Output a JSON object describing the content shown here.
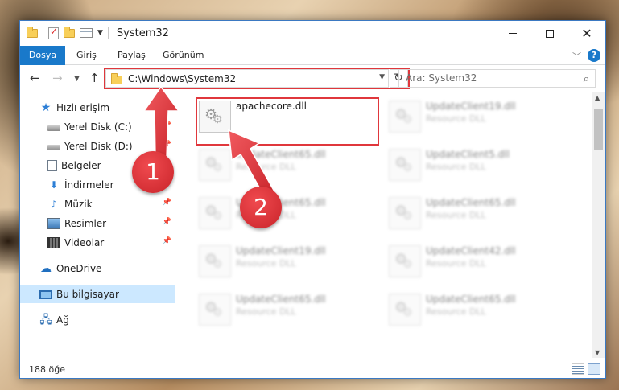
{
  "window": {
    "title": "System32"
  },
  "ribbon": {
    "tabs": [
      "Dosya",
      "Giriş",
      "Paylaş",
      "Görünüm"
    ],
    "help": "?"
  },
  "navigation": {
    "address": "C:\\Windows\\System32",
    "search_placeholder": "Ara: System32"
  },
  "sidebar": {
    "items": [
      {
        "label": "Hızlı erişim",
        "icon": "star-icon"
      },
      {
        "label": "Yerel Disk (C:)",
        "icon": "disk-icon",
        "pinned": true
      },
      {
        "label": "Yerel Disk (D:)",
        "icon": "disk-icon",
        "pinned": true
      },
      {
        "label": "Belgeler",
        "icon": "document-icon",
        "pinned": true
      },
      {
        "label": "İndirmeler",
        "icon": "download-icon",
        "pinned": true
      },
      {
        "label": "Müzik",
        "icon": "music-icon",
        "pinned": true
      },
      {
        "label": "Resimler",
        "icon": "pictures-icon",
        "pinned": true
      },
      {
        "label": "Videolar",
        "icon": "videos-icon",
        "pinned": true
      },
      {
        "label": "OneDrive",
        "icon": "cloud-icon"
      },
      {
        "label": "Bu bilgisayar",
        "icon": "computer-icon",
        "selected": true
      },
      {
        "label": "Ağ",
        "icon": "network-icon"
      }
    ]
  },
  "files": [
    {
      "name": "apachecore.dll",
      "type": "",
      "highlighted": true
    },
    {
      "name": "UpdateClient19.dll",
      "type": "Resource DLL",
      "blurred": true
    },
    {
      "name": "UpdateClient65.dll",
      "type": "Resource DLL",
      "blurred": true
    },
    {
      "name": "UpdateClient5.dll",
      "type": "Resource DLL",
      "blurred": true
    },
    {
      "name": "UpdateClient65.dll",
      "type": "Resource DLL",
      "blurred": true
    },
    {
      "name": "UpdateClient65.dll",
      "type": "Resource DLL",
      "blurred": true
    },
    {
      "name": "UpdateClient19.dll",
      "type": "Resource DLL",
      "blurred": true
    },
    {
      "name": "UpdateClient42.dll",
      "type": "Resource DLL",
      "blurred": true
    },
    {
      "name": "UpdateClient65.dll",
      "type": "Resource DLL",
      "blurred": true
    },
    {
      "name": "UpdateClient65.dll",
      "type": "Resource DLL",
      "blurred": true
    }
  ],
  "status": {
    "item_count": "188 öğe"
  },
  "annotations": {
    "marker1": "1",
    "marker2": "2",
    "color": "#e0373c"
  }
}
